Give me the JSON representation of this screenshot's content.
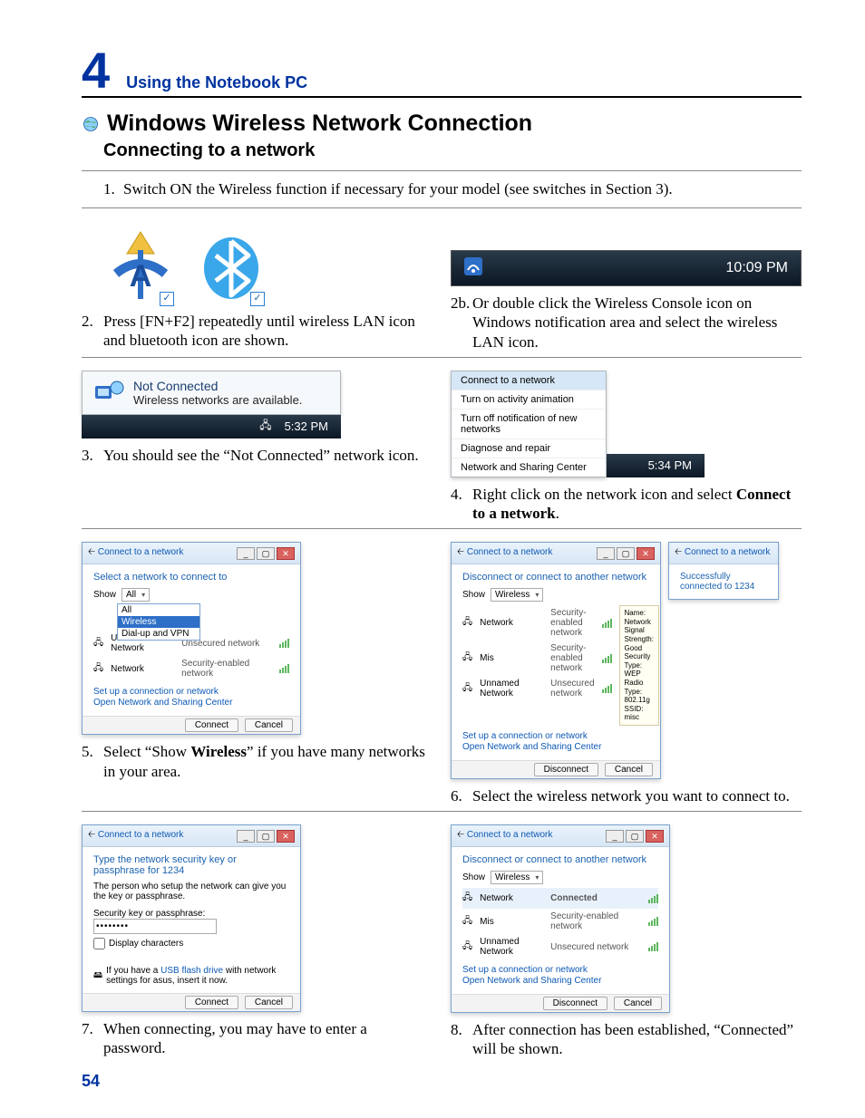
{
  "chapter": {
    "num": "4",
    "title": "Using the Notebook PC"
  },
  "heading": "Windows Wireless Network Connection",
  "subheading": "Connecting to a network",
  "page_number": "54",
  "steps": {
    "s1": {
      "num": "1.",
      "text": "Switch ON the Wireless function if necessary for your model (see switches in Section 3)."
    },
    "s2": {
      "num": "2.",
      "text": "Press [FN+F2] repeatedly until wireless LAN icon and bluetooth icon are shown."
    },
    "s2b": {
      "num": "2b.",
      "text": "Or double click the Wireless Console icon on Windows notification area and select the wireless LAN icon."
    },
    "s3": {
      "num": "3.",
      "text": "You should see the “Not Connected” network icon."
    },
    "s4": {
      "num": "4.",
      "pre": "Right click on the network icon and select ",
      "bold": "Connect to a network",
      "post": "."
    },
    "s5": {
      "num": "5.",
      "pre": "Select “Show ",
      "bold": "Wireless",
      "post": "” if you have many networks in your area."
    },
    "s6": {
      "num": "6.",
      "text": "Select the wireless network you want to connect to."
    },
    "s7": {
      "num": "7.",
      "text": "When connecting, you may have to enter a password."
    },
    "s8": {
      "num": "8.",
      "text": "After connection has been established, “Connected” will be shown."
    }
  },
  "taskbar": {
    "time1": "10:09 PM",
    "time3": "5:32 PM",
    "time4": "5:34 PM"
  },
  "popup3": {
    "title": "Not Connected",
    "msg": "Wireless networks are available."
  },
  "menu4": {
    "connect": "Connect to a network",
    "anim": "Turn on activity animation",
    "notif": "Turn off notification of new networks",
    "diag": "Diagnose and repair",
    "center": "Network and Sharing Center"
  },
  "win5": {
    "title": "Connect to a network",
    "head": "Select a network to connect to",
    "show": "Show",
    "show_val": "All",
    "opt_wireless": "Wireless",
    "opt_dial": "Dial-up and VPN",
    "rows": [
      {
        "name": "Unnamed Network",
        "type": "Unsecured network"
      },
      {
        "name": "Network",
        "type": "Security-enabled network"
      }
    ],
    "link1": "Set up a connection or network",
    "link2": "Open Network and Sharing Center",
    "connect_btn": "Connect",
    "cancel_btn": "Cancel"
  },
  "win6": {
    "title": "Connect to a network",
    "head": "Disconnect or connect to another network",
    "show": "Show",
    "show_val": "Wireless",
    "rows": [
      {
        "name": "Network",
        "type": "Security-enabled network"
      },
      {
        "name": "Mis",
        "type": "Security-enabled network"
      },
      {
        "name": "Unnamed Network",
        "type": "Unsecured network"
      }
    ],
    "tip": "Name: Network\nSignal Strength: Good\nSecurity Type: WEP\nRadio Type: 802.11g\nSSID: misc",
    "disconnect_btn": "Disconnect",
    "cancel_btn": "Cancel",
    "side_title": "Connect to a network",
    "side_msg": "Successfully connected to 1234"
  },
  "win7": {
    "title": "Connect to a network",
    "head": "Type the network security key or passphrase for 1234",
    "sub": "The person who setup the network can give you the key or passphrase.",
    "label": "Security key or passphrase:",
    "value": "••••••••",
    "display": "Display characters",
    "usb_pre": "If you have a ",
    "usb_link": "USB flash drive",
    "usb_post": " with network settings for asus, insert it now.",
    "connect_btn": "Connect",
    "cancel_btn": "Cancel"
  },
  "win8": {
    "title": "Connect to a network",
    "head": "Disconnect or connect to another network",
    "show": "Show",
    "show_val": "Wireless",
    "rows": [
      {
        "name": "Network",
        "type": "Connected"
      },
      {
        "name": "Mis",
        "type": "Security-enabled network"
      },
      {
        "name": "Unnamed Network",
        "type": "Unsecured network"
      }
    ],
    "disconnect_btn": "Disconnect",
    "cancel_btn": "Cancel"
  }
}
